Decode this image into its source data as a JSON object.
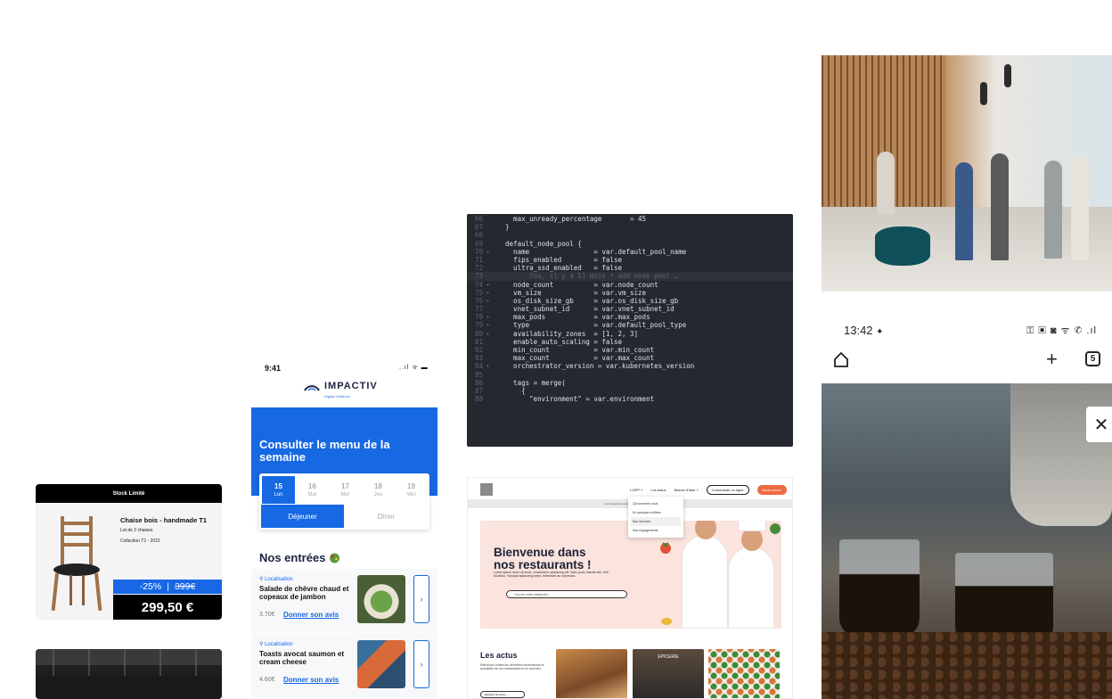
{
  "product_card": {
    "banner": "Stock Limité",
    "title": "Chaise bois - handmade T1",
    "subtitle": "Lot de 2 chaises",
    "collection": "Collection T2 - 2022",
    "discount": "-25%",
    "separator": "|",
    "old_price": "399€",
    "price": "299,50 €"
  },
  "menu_app": {
    "status_time": "9:41",
    "status_icons": "..ıl ᯤ ▬",
    "logo_name": "IMPACTIV",
    "logo_tagline": "Digital Solutions",
    "hero_title": "Consulter le menu de la semaine",
    "days": [
      {
        "num": "15",
        "label": "Lun"
      },
      {
        "num": "16",
        "label": "Mar"
      },
      {
        "num": "17",
        "label": "Mer"
      },
      {
        "num": "18",
        "label": "Jeu"
      },
      {
        "num": "19",
        "label": "Ven"
      }
    ],
    "meals": {
      "lunch": "Déjeuner",
      "dinner": "Dîner"
    },
    "section_title": "Nos entrées",
    "items": [
      {
        "location": "Localisation",
        "name": "Salade de chèvre chaud et copeaux de jambon",
        "price": "3.70€",
        "link": "Donner son avis"
      },
      {
        "location": "Localisation",
        "name": "Toasts avocat saumon et cream cheese",
        "price": "4.60€",
        "link": "Donner son avis"
      }
    ],
    "chevron": "›"
  },
  "code_editor": {
    "lines": [
      {
        "n": "66",
        "text": "    max_unready_percentage       = 45",
        "mark": ""
      },
      {
        "n": "67",
        "text": "  }",
        "mark": ""
      },
      {
        "n": "68",
        "text": "",
        "mark": ""
      },
      {
        "n": "69",
        "text": "  default_node_pool {",
        "mark": ""
      },
      {
        "n": "70",
        "text": "    name                = var.default_pool_name",
        "mark": "▸"
      },
      {
        "n": "71",
        "text": "    fips_enabled        = false",
        "mark": ""
      },
      {
        "n": "72",
        "text": "    ultra_ssd_enabled   = false",
        "mark": ""
      },
      {
        "n": "73",
        "text": "        You, il y a 11 mois • add node pool …",
        "mark": ""
      },
      {
        "n": "74",
        "text": "    node_count          = var.node_count",
        "mark": "▸"
      },
      {
        "n": "75",
        "text": "    vm_size             = var.vm_size",
        "mark": "▸"
      },
      {
        "n": "76",
        "text": "    os_disk_size_gb     = var.os_disk_size_gb",
        "mark": "▸"
      },
      {
        "n": "77",
        "text": "    vnet_subnet_id      = var.vnet_subnet_id",
        "mark": ""
      },
      {
        "n": "78",
        "text": "    max_pods            = var.max_pods",
        "mark": "▸"
      },
      {
        "n": "79",
        "text": "    type                = var.default_pool_type",
        "mark": "▸"
      },
      {
        "n": "80",
        "text": "    availability_zones  = [1, 2, 3]",
        "mark": "▸"
      },
      {
        "n": "81",
        "text": "    enable_auto_scaling = false",
        "mark": ""
      },
      {
        "n": "82",
        "text": "    min_count           = var.min_count",
        "mark": ""
      },
      {
        "n": "83",
        "text": "    max_count           = var.max_count",
        "mark": ""
      },
      {
        "n": "84",
        "text": "    orchestrator_version = var.kubernetes_version",
        "mark": "▸"
      },
      {
        "n": "85",
        "text": "",
        "mark": ""
      },
      {
        "n": "86",
        "text": "    tags = merge(",
        "mark": ""
      },
      {
        "n": "87",
        "text": "      {",
        "mark": ""
      },
      {
        "n": "88",
        "text": "        \"environment\" = var.environment",
        "mark": ""
      }
    ],
    "highlight_line": "73"
  },
  "website": {
    "nav": {
      "brand_menu": "L'APP ˅",
      "news": "Les actus",
      "help": "Besoin d'aide ?",
      "order": "Commande en ligne",
      "cta": "Nous suivre"
    },
    "banner": "Les restaurants sont fermés ... En savoir plus",
    "dropdown": [
      "Qui sommes-nous",
      "En quelques chiffres",
      "Nos services",
      "Nos engagements"
    ],
    "hero_title_1": "Bienvenue dans",
    "hero_title_2": "nos restaurants !",
    "hero_text": "Lorem ipsum dolor sit amet, consectetur adipiscing elit. Nam, justo blandit nisl, velit faucibus. Volutpat adipiscing tortor, bibendum ac commodo.",
    "search_placeholder": "Trouver votre restaurant...",
    "news_title": "Les actus",
    "news_text": "Retrouvez toutes les dernières informations et actualités de vos restaurants en un seul clic.",
    "news_button": "Explorer les actus  →",
    "tile_caption": "EPICERIE"
  },
  "android_browser": {
    "time": "13:42",
    "status_icons": "⚿ ▣ ◙ ᯤ ✆ .ıl",
    "plus": "+",
    "tab_count": "5",
    "close": "✕"
  }
}
